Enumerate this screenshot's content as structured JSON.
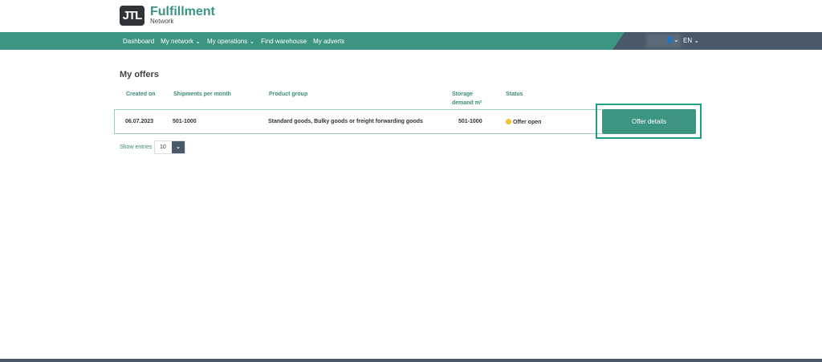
{
  "logo": {
    "mark": "JTL",
    "title": "Fulfillment",
    "subtitle": "Network"
  },
  "nav": {
    "items": [
      "Dashboard",
      "My network ⌄",
      "My operations ⌄",
      "Find warehouse",
      "My adverts"
    ],
    "user": "👤⌄",
    "lang": "EN ⌄"
  },
  "page": {
    "title": "My offers"
  },
  "table": {
    "headers": [
      "Created on",
      "Shipments per month",
      "Product group",
      "Storage demand m²",
      "Status"
    ],
    "rows": [
      {
        "created": "06.07.2023",
        "shipments": "501-1000",
        "group": "Standard goods, Bulky goods or freight forwarding goods",
        "storage": "501-1000",
        "status": "Offer open",
        "action": "Offer details"
      }
    ]
  },
  "pager": {
    "label": "Show entries",
    "value": "10"
  },
  "colors": {
    "brand": "#3c9483",
    "dark": "#4a5968",
    "status_open": "#f5c233"
  }
}
